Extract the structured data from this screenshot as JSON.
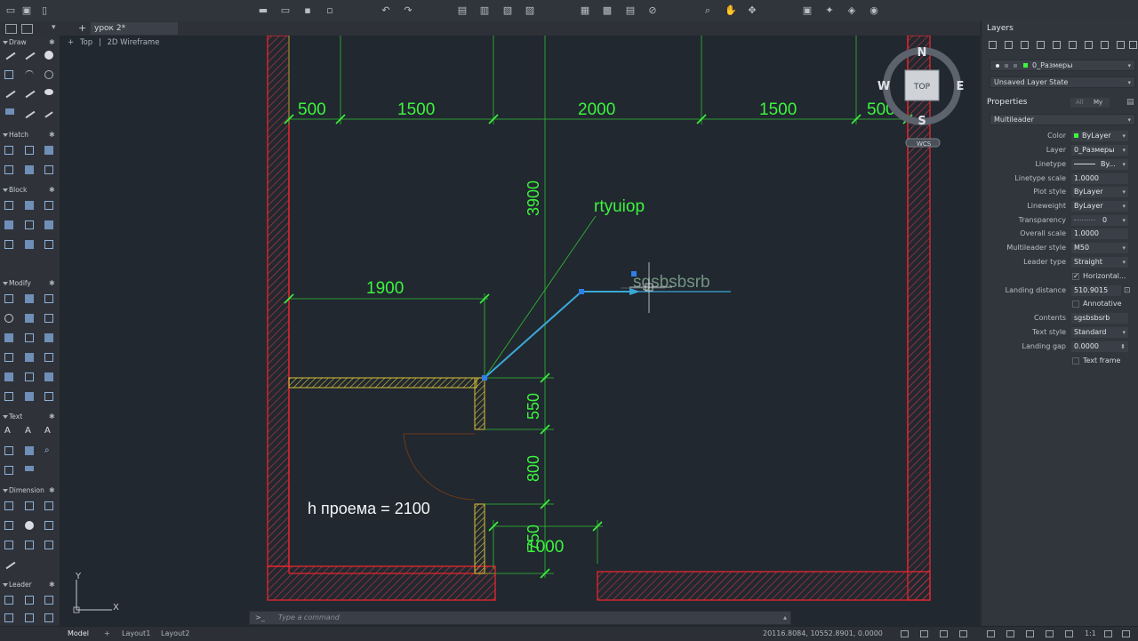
{
  "tabs": {
    "document": "урок 2*"
  },
  "viewport": {
    "view": "Top",
    "style": "2D Wireframe"
  },
  "left_sections": [
    "Draw",
    "Hatch",
    "Block",
    "Modify",
    "Text",
    "Dimension",
    "Leader"
  ],
  "drawing": {
    "dims_top": [
      "500",
      "1500",
      "2000",
      "1500",
      "500"
    ],
    "dim_vertical_main": "3900",
    "dim_1900": "1900",
    "dim_550": "550",
    "dim_800": "800",
    "dim_1000": "1000",
    "dim_750": "750",
    "leader1_text": "rtyuiop",
    "leader2_text": "sgsbsbsrb",
    "note": "h проема = 2100",
    "ucs_y": "Y",
    "ucs_x": "X"
  },
  "viewcube": {
    "n": "N",
    "s": "S",
    "w": "W",
    "e": "E",
    "face": "TOP",
    "wcs": "WCS"
  },
  "command": {
    "prompt": ">_",
    "placeholder": "Type a command"
  },
  "status": {
    "model": "Model",
    "layout1": "Layout1",
    "layout2": "Layout2",
    "coords": "20116.8084, 10552.8901, 0.0000",
    "scale": "1:1"
  },
  "layers": {
    "title": "Layers",
    "current_layer": "0_Размеры",
    "layer_state": "Unsaved Layer State"
  },
  "properties": {
    "title": "Properties",
    "object_type": "Multileader",
    "tab_all": "All",
    "tab_my": "My",
    "rows": [
      {
        "label": "Color",
        "value": "ByLayer"
      },
      {
        "label": "Layer",
        "value": "0_Размеры"
      },
      {
        "label": "Linetype",
        "value": "By..."
      },
      {
        "label": "Linetype scale",
        "value": "1.0000"
      },
      {
        "label": "Plot style",
        "value": "ByLayer"
      },
      {
        "label": "Lineweight",
        "value": "ByLayer"
      },
      {
        "label": "Transparency",
        "value": "0"
      },
      {
        "label": "Overall scale",
        "value": "1.0000"
      },
      {
        "label": "Multileader style",
        "value": "M50"
      },
      {
        "label": "Leader type",
        "value": "Straight"
      }
    ],
    "horizontal": "Horizontal...",
    "landing_distance_label": "Landing distance",
    "landing_distance": "510.9015",
    "annotative": "Annotative",
    "contents_label": "Contents",
    "contents": "sgsbsbsrb",
    "text_style_label": "Text style",
    "text_style": "Standard",
    "landing_gap_label": "Landing gap",
    "landing_gap": "0.0000",
    "text_frame": "Text frame"
  }
}
